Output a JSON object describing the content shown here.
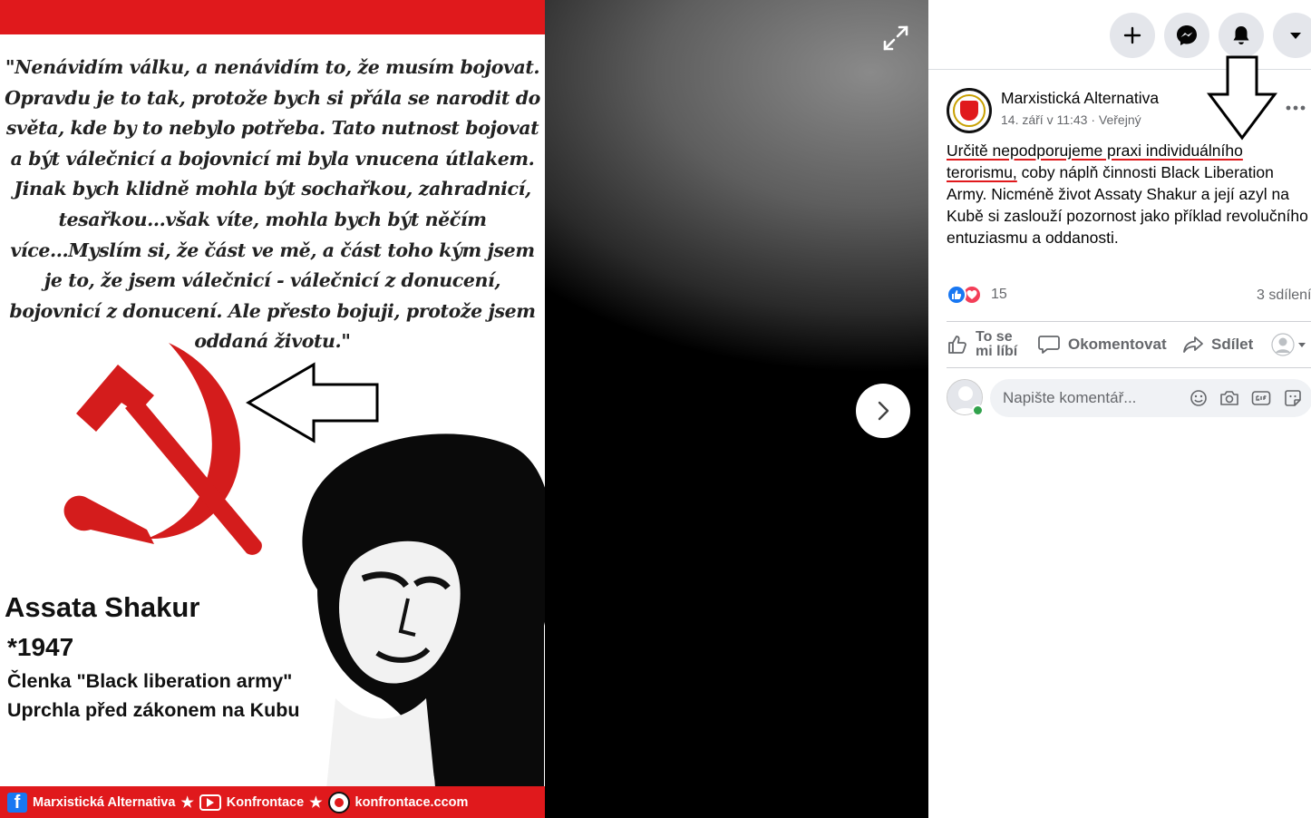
{
  "viewer": {
    "poster": {
      "quote": "\"Nenávidím válku, a nenávidím to, že musím bojovat. Opravdu je to tak, protože bych si přála se narodit do světa, kde by to nebylo potřeba. Tato nutnost bojovat a být válečnicí a bojovnicí mi byla vnucena útlakem. Jinak bych klidně mohla být sochařkou, zahradnicí, tesařkou...však víte, mohla bych být něčím více...Myslím si, že část ve mě, a část toho kým jsem je to, že jsem válečnicí - válečnicí z donucení, bojovnicí z donucení. Ale přesto bojuji, protože jsem oddaná životu.\"",
      "name": "Assata Shakur",
      "born": "*1947",
      "member": "Členka \"Black liberation army\"",
      "fled": "Uprchla před zákonem na Kubu",
      "footer": {
        "facebook": "Marxistická Alternativa",
        "youtube": "Konfrontace",
        "website": "konfrontace.ccom",
        "separator": "★"
      },
      "colors": {
        "accent_red": "#e0191c"
      }
    },
    "icons": {
      "expand": "expand-icon",
      "next": "chevron-right-icon"
    }
  },
  "panel": {
    "header_icons": [
      "plus-icon",
      "messenger-icon",
      "bell-icon",
      "caret-down-icon"
    ],
    "post": {
      "page_name": "Marxistická Alternativa",
      "meta": "14. září v 11:43 · Veřejný",
      "text_highlight_1": "Určitě nepodporujeme praxi individuálního",
      "text_highlight_2": "terorismu,",
      "text_rest": " coby náplň činnosti Black Liberation Army. Nicméně život Assaty Shakur a její azyl na Kubě si zaslouží pozornost jako příklad revolučního entuziasmu a oddanosti.",
      "reaction_count": "15",
      "share_count": "3 sdílení",
      "actions": {
        "like_line1": "To se",
        "like_line2": "mi líbí",
        "comment": "Okomentovat",
        "share": "Sdílet"
      },
      "comment_placeholder": "Napište komentář..."
    },
    "colors": {
      "brand_blue": "#1877f2",
      "love_red": "#f33e58",
      "online_green": "#31a24c",
      "annotation_red": "#e0191c"
    }
  }
}
